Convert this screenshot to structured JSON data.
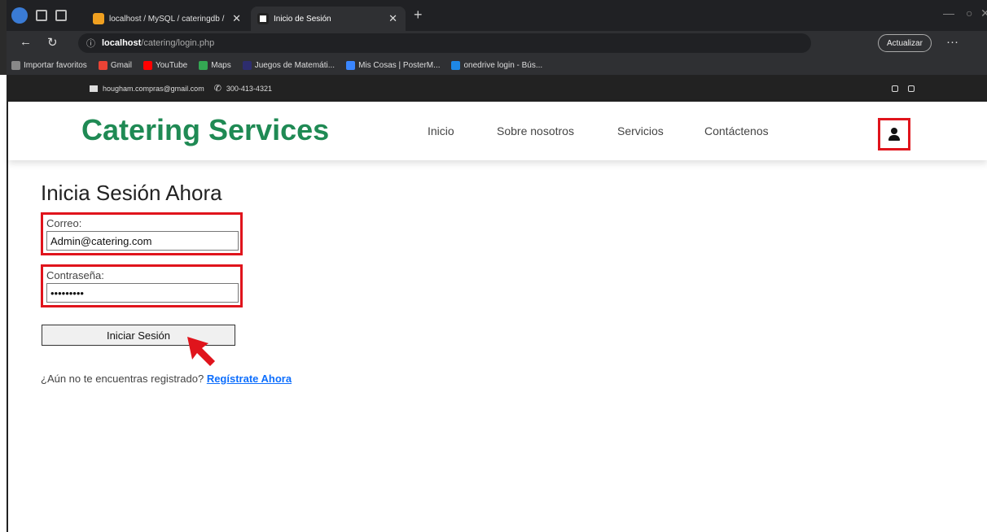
{
  "browser": {
    "tabs": [
      {
        "label": "localhost / MySQL / cateringdb /",
        "favicon_color": "#f0a020"
      },
      {
        "label": "Inicio de Sesión",
        "favicon_color": "#222222"
      }
    ],
    "new_tab": "+",
    "url": {
      "host": "localhost",
      "path": "/catering/login.php"
    },
    "update_button": "Actualizar",
    "favorites": [
      {
        "label": "Importar favoritos",
        "color": "#888888"
      },
      {
        "label": "Gmail",
        "color": "#ea4335"
      },
      {
        "label": "YouTube",
        "color": "#ff0000"
      },
      {
        "label": "Maps",
        "color": "#34a853"
      },
      {
        "label": "Juegos de Matemáti...",
        "color": "#2d2d6e"
      },
      {
        "label": "Mis Cosas | PosterM...",
        "color": "#3a86ff"
      },
      {
        "label": "onedrive login - Bús...",
        "color": "#1e88e5"
      }
    ]
  },
  "topbar": {
    "email": "hougham.compras@gmail.com",
    "phone": "300-413-4321"
  },
  "header": {
    "brand": "Catering Services",
    "brand_color": "#1f8a54",
    "menu": [
      "Inicio",
      "Sobre nosotros",
      "Servicios",
      "Contáctenos"
    ]
  },
  "login": {
    "title": "Inicia Sesión Ahora",
    "email_label": "Correo:",
    "email_value": "Admin@catering.com",
    "password_label": "Contraseña:",
    "password_value": "•••••••••",
    "submit_label": "Iniciar Sesión",
    "register_prompt": "¿Aún no te encuentras registrado?",
    "register_link": "Regístrate Ahora"
  },
  "colors": {
    "highlight": "#e0141c",
    "link": "#0d6efd"
  }
}
